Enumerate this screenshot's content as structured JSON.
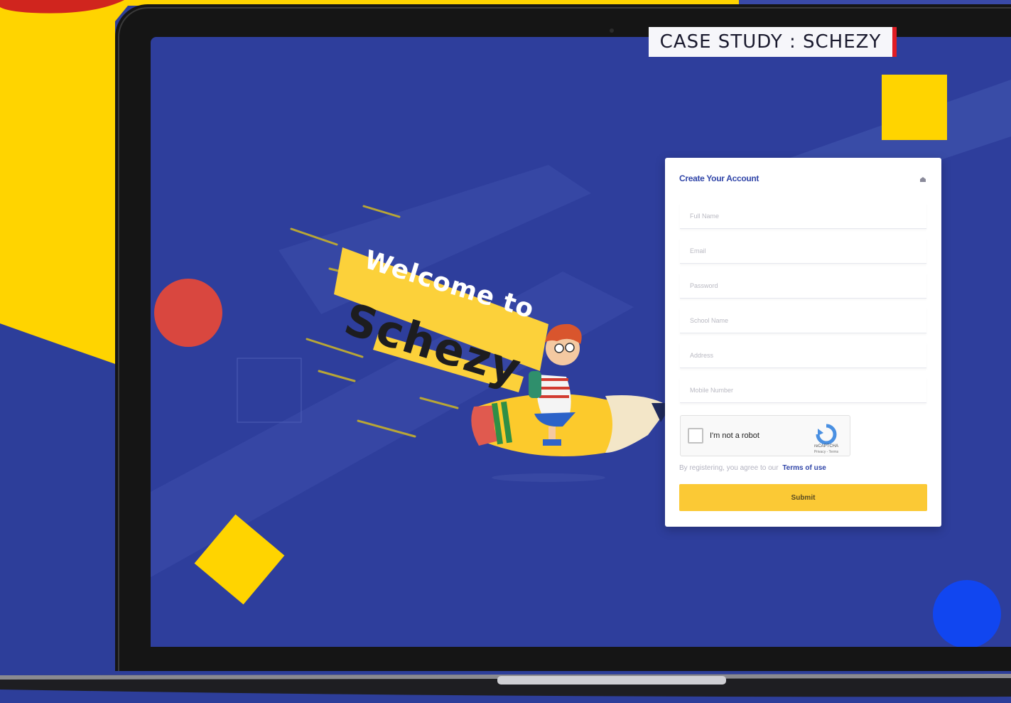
{
  "badge": {
    "label": "CASE STUDY : SCHEZY"
  },
  "hero": {
    "welcome": "Welcome to",
    "brand": "Schezy"
  },
  "form": {
    "title": "Create Your Account",
    "fields": [
      {
        "placeholder": "Full Name"
      },
      {
        "placeholder": "Email"
      },
      {
        "placeholder": "Password"
      },
      {
        "placeholder": "School Name"
      },
      {
        "placeholder": "Address"
      },
      {
        "placeholder": "Mobile Number"
      }
    ],
    "captcha": {
      "label": "I'm not a robot",
      "brand": "reCAPTCHA",
      "sub": "Privacy - Terms"
    },
    "terms_prefix": "By registering, you agree to our",
    "terms_link": "Terms of use",
    "submit_label": "Submit"
  },
  "colors": {
    "background": "#2d3e9a",
    "accent_yellow": "#ffd400",
    "button": "#fbc935",
    "badge_bar": "#e01c24",
    "title_blue": "#3146a8"
  }
}
